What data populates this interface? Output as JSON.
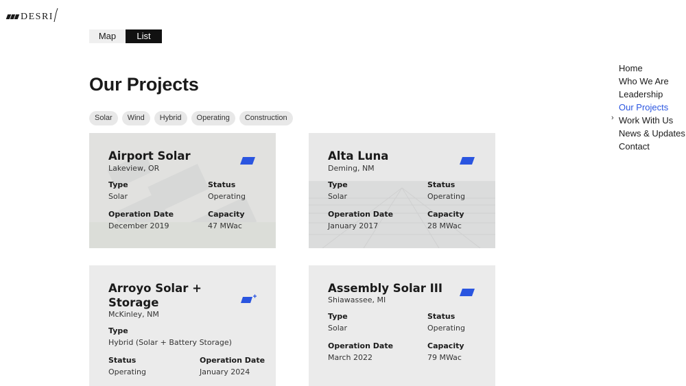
{
  "brand": {
    "logo_text": "DESRI"
  },
  "view_toggle": {
    "map": "Map",
    "list": "List"
  },
  "page_title": "Our Projects",
  "filters": [
    "Solar",
    "Wind",
    "Hybrid",
    "Operating",
    "Construction"
  ],
  "labels": {
    "type": "Type",
    "status": "Status",
    "operation_date": "Operation Date",
    "capacity": "Capacity"
  },
  "projects": [
    {
      "name": "Airport Solar",
      "location": "Lakeview, OR",
      "type": "Solar",
      "status": "Operating",
      "operation_date": "December 2019",
      "capacity": "47 MWac",
      "icon": "solar-panel-icon"
    },
    {
      "name": "Alta Luna",
      "location": "Deming, NM",
      "type": "Solar",
      "status": "Operating",
      "operation_date": "January 2017",
      "capacity": "28 MWac",
      "icon": "solar-panel-icon"
    },
    {
      "name": "Arroyo Solar + Storage",
      "name_line1": "Arroyo Solar +",
      "name_line2": "Storage",
      "location": "McKinley, NM",
      "type": "Hybrid (Solar + Battery Storage)",
      "status": "Operating",
      "operation_date": "January 2024",
      "icon": "solar-plus-storage-icon"
    },
    {
      "name": "Assembly Solar III",
      "location": "Shiawassee, MI",
      "type": "Solar",
      "status": "Operating",
      "operation_date": "March 2022",
      "capacity": "79 MWac",
      "icon": "solar-panel-icon"
    }
  ],
  "nav": {
    "items": [
      "Home",
      "Who We Are",
      "Leadership",
      "Our Projects",
      "Work With Us",
      "News & Updates",
      "Contact"
    ],
    "active": "Our Projects",
    "chevron": "›"
  },
  "colors": {
    "accent": "#2a55e0",
    "card_bg": "#ebebeb",
    "toggle_active": "#111111",
    "chip_bg": "#e8e8e8"
  }
}
